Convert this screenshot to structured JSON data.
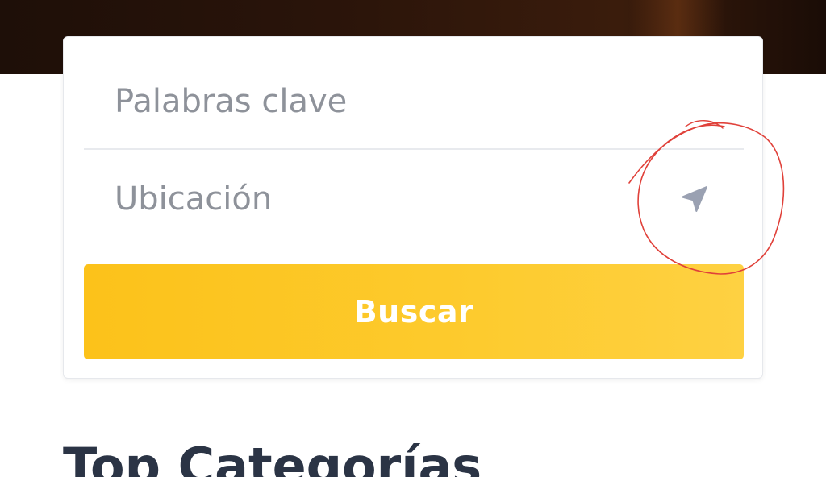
{
  "search": {
    "keywords_placeholder": "Palabras clave",
    "location_placeholder": "Ubicación",
    "locate_icon": "navigation-arrow-icon",
    "submit_label": "Buscar"
  },
  "section": {
    "title": "Top Categorías"
  },
  "colors": {
    "button": "#fcc21a",
    "placeholder": "#8e929a",
    "icon": "#9aa1b2",
    "annotation": "#e0413a",
    "heading": "#2b3445"
  }
}
